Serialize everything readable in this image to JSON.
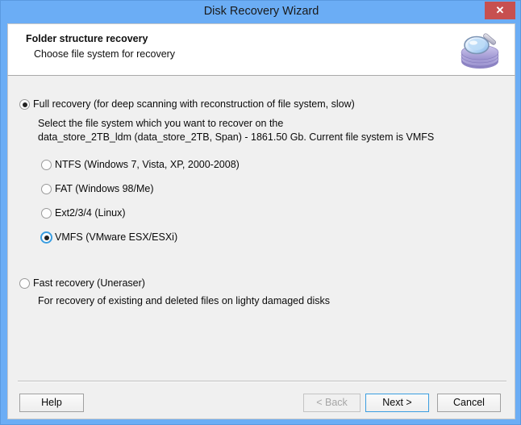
{
  "window": {
    "title": "Disk Recovery Wizard",
    "close_label": "✕",
    "frame_color": "#6BADF5",
    "close_color": "#c75050"
  },
  "header": {
    "title": "Folder structure recovery",
    "subtitle": "Choose file system for recovery",
    "icon": "magnifier-disk-icon"
  },
  "main": {
    "full_recovery": {
      "label": "Full recovery (for deep scanning with reconstruction of file system, slow)",
      "checked": true,
      "description_line1": "Select the file system which you want to recover on the",
      "description_line2": "data_store_2TB_ldm (data_store_2TB, Span) - 1861.50 Gb. Current file system is VMFS"
    },
    "filesystems": [
      {
        "label": "NTFS (Windows 7, Vista, XP, 2000-2008)",
        "checked": false,
        "focused": false
      },
      {
        "label": "FAT (Windows 98/Me)",
        "checked": false,
        "focused": false
      },
      {
        "label": "Ext2/3/4 (Linux)",
        "checked": false,
        "focused": false
      },
      {
        "label": "VMFS (VMware ESX/ESXi)",
        "checked": true,
        "focused": true
      }
    ],
    "fast_recovery": {
      "label": "Fast recovery (Uneraser)",
      "checked": false,
      "description": "For recovery of existing and deleted files on lighty damaged disks"
    }
  },
  "buttons": {
    "help": "Help",
    "back": "< Back",
    "next": "Next >",
    "cancel": "Cancel",
    "back_disabled": true,
    "next_is_default": true
  }
}
